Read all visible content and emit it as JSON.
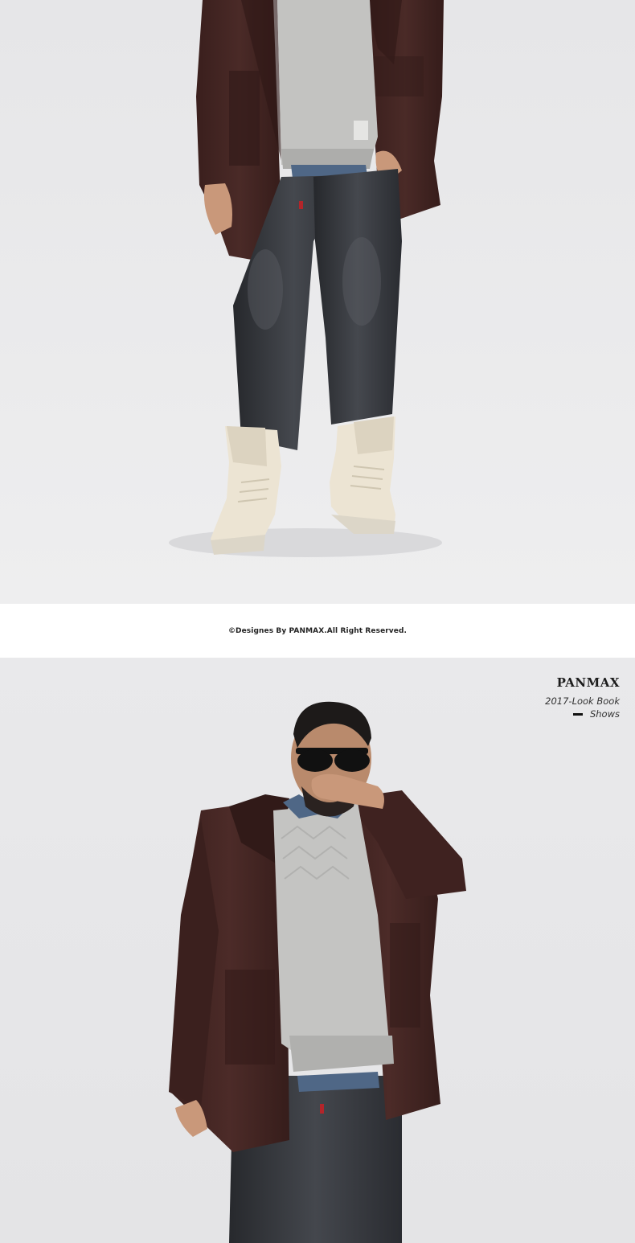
{
  "footer": {
    "copyright": "©Designes By PANMAX.All Right Reserved."
  },
  "brand": {
    "name": "PANMAX",
    "subtitle": "2017-Look Book",
    "tagline": "Shows"
  },
  "colors": {
    "background": "#e7e7e9",
    "coat": "#3e2220",
    "sweater": "#c2c2c0",
    "jeans": "#2f3136",
    "boots": "#ebe3d2"
  }
}
